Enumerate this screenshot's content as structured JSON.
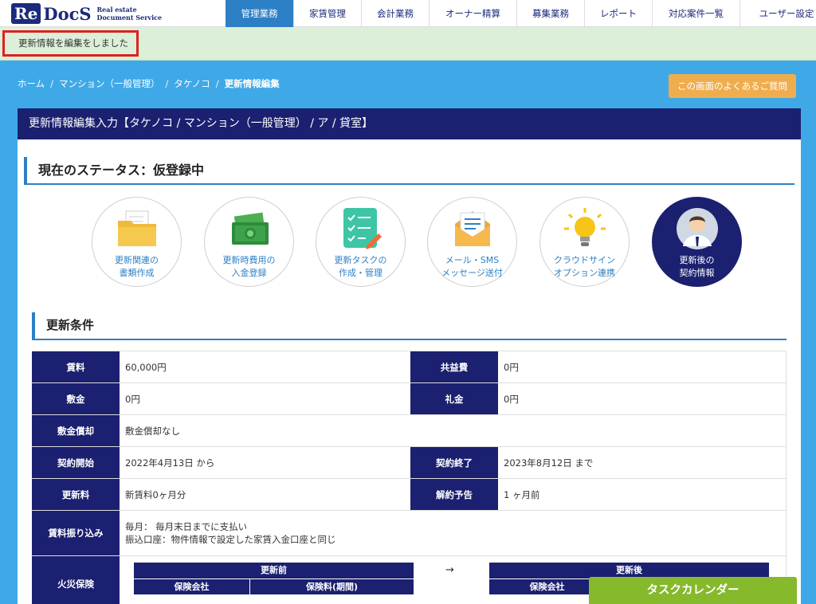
{
  "logo": {
    "mark": "Re",
    "name": "DocS",
    "sub1": "Real estate",
    "sub2": "Document Service"
  },
  "nav": [
    "管理業務",
    "家賃管理",
    "会計業務",
    "オーナー精算",
    "募集業務",
    "レポート",
    "対応案件一覧",
    "ユーザー設定"
  ],
  "flash": {
    "message": "更新情報を編集をしました"
  },
  "breadcrumb": {
    "home": "ホーム",
    "property": "マンション（一般管理）",
    "tenant": "タケノコ",
    "current": "更新情報編集"
  },
  "faq_button": "この画面のよくあるご質問",
  "panel": {
    "title": "更新情報編集入力【タケノコ / マンション（一般管理） / ア / 貸室】"
  },
  "status": {
    "label": "現在のステータス：仮登録中"
  },
  "steps": [
    {
      "line1": "更新関連の",
      "line2": "書類作成",
      "icon": "folder-icon"
    },
    {
      "line1": "更新時費用の",
      "line2": "入金登録",
      "icon": "money-icon"
    },
    {
      "line1": "更新タスクの",
      "line2": "作成・管理",
      "icon": "checklist-icon"
    },
    {
      "line1": "メール・SMS",
      "line2": "メッセージ送付",
      "icon": "mail-icon"
    },
    {
      "line1": "クラウドサイン",
      "line2": "オプション連携",
      "icon": "lightbulb-icon"
    },
    {
      "line1": "更新後の",
      "line2": "契約情報",
      "icon": "person-icon"
    }
  ],
  "conditions": {
    "heading": "更新条件",
    "rent_label": "賃料",
    "rent": "60,000円",
    "common_fee_label": "共益費",
    "common_fee": "0円",
    "deposit_label": "敷金",
    "deposit": "0円",
    "key_money_label": "礼金",
    "key_money": "0円",
    "deposit_amort_label": "敷金償却",
    "deposit_amort": "敷金償却なし",
    "start_label": "契約開始",
    "start": "2022年4月13日 から",
    "end_label": "契約終了",
    "end": "2023年8月12日 まで",
    "renewal_fee_label": "更新料",
    "renewal_fee": "新賃料0ヶ月分",
    "notice_label": "解約予告",
    "notice": "1 ヶ月前",
    "transfer_label": "賃料振り込み",
    "transfer_line1": "毎月： 毎月末日までに支払い",
    "transfer_line2": "振込口座：物件情報で設定した家賃入金口座と同じ",
    "insurance_label": "火災保険",
    "ins_before": "更新前",
    "ins_company": "保険会社",
    "ins_fee": "保険料(期間)",
    "ins_arrow": "→",
    "ins_after": "更新後",
    "ins_company2": "保険会社"
  },
  "task_calendar": "タスクカレンダー"
}
